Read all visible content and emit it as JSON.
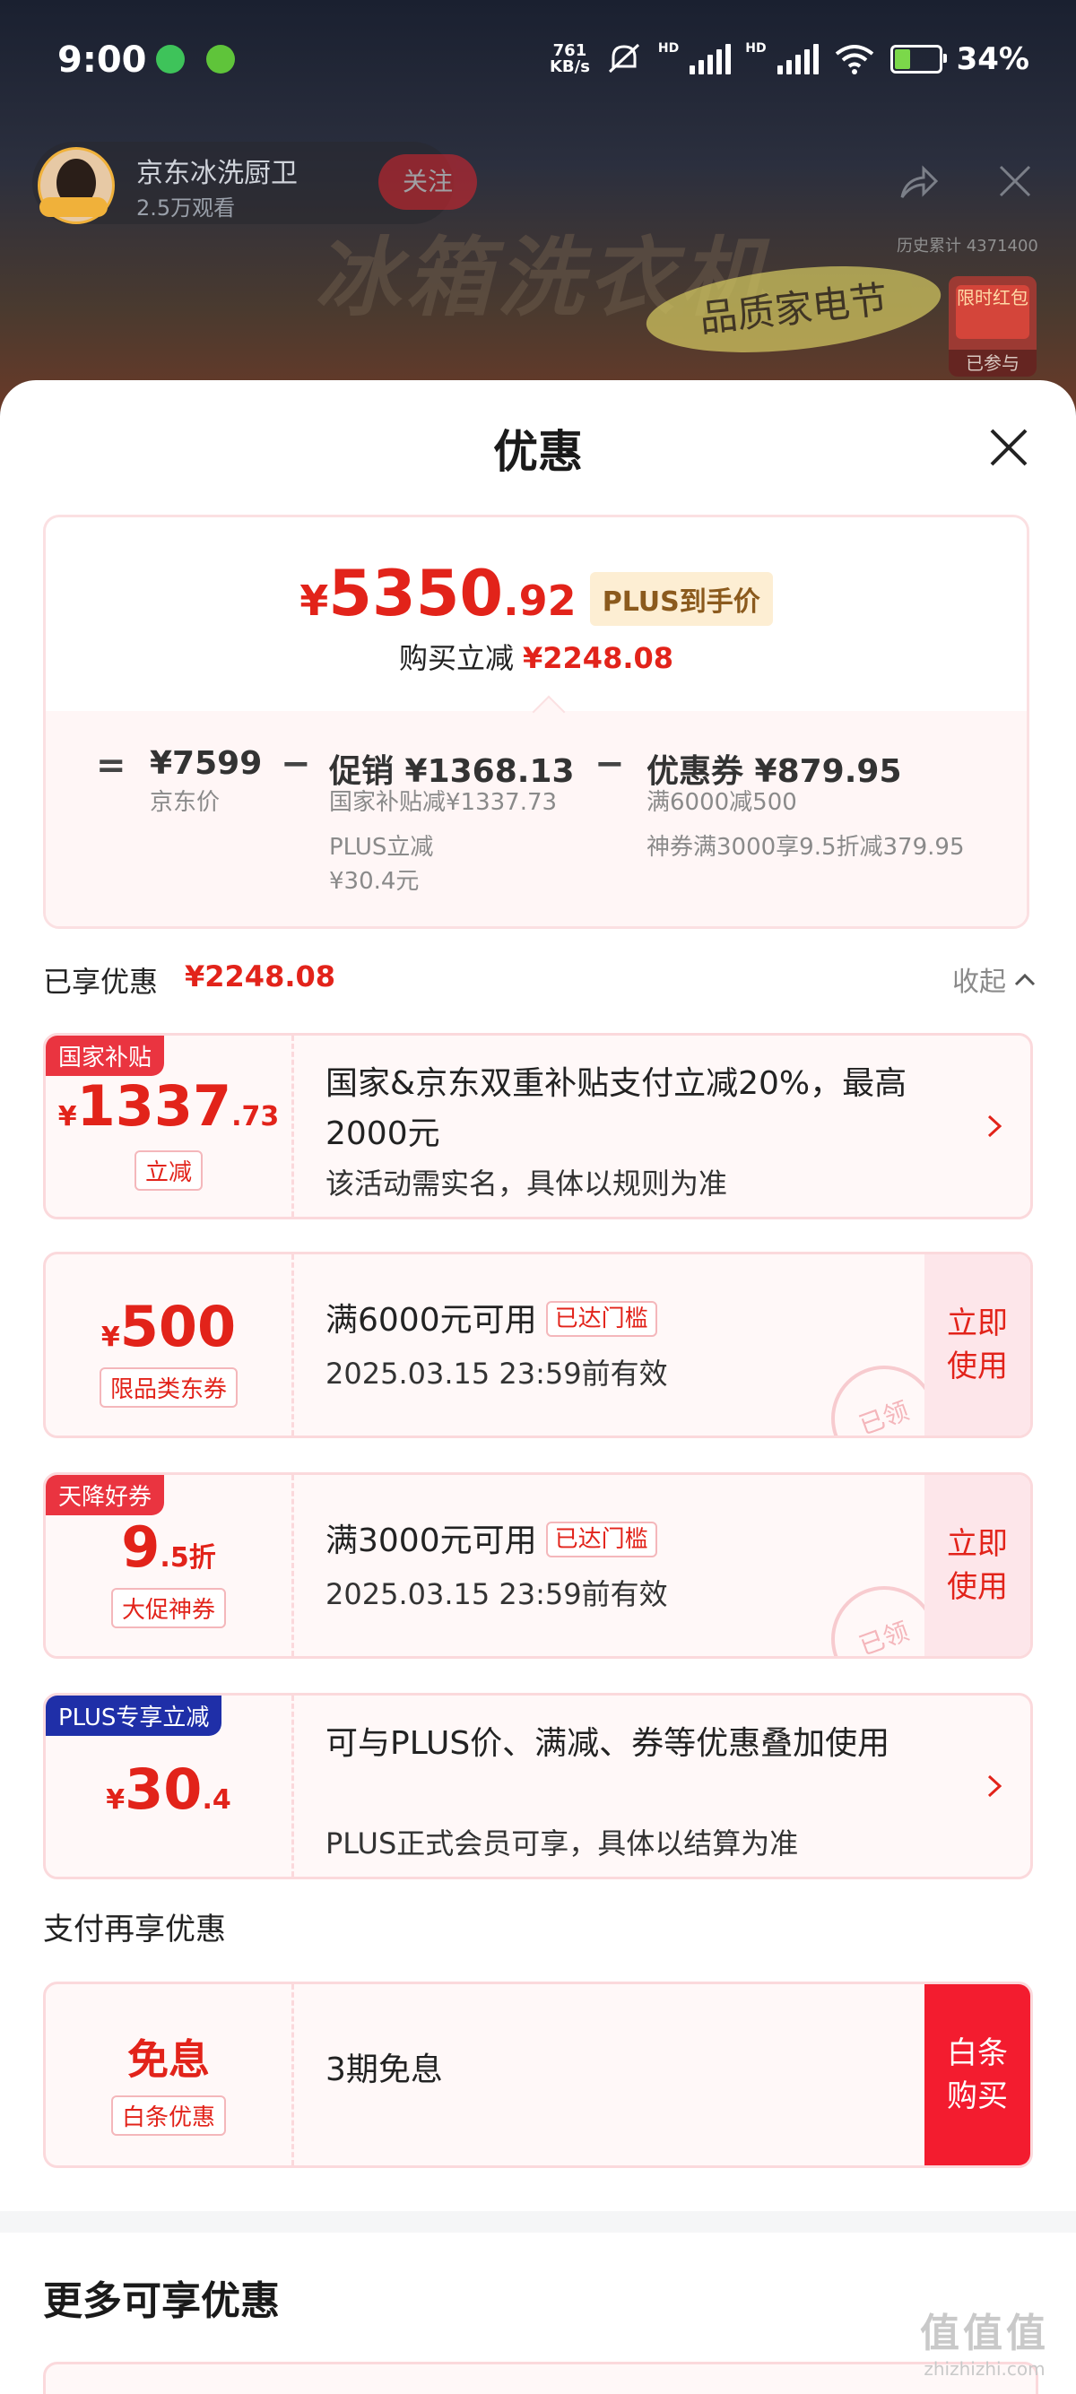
{
  "status": {
    "time": "9:00",
    "speed": "761",
    "speed_unit": "KB/s",
    "hd": "HD",
    "battery": "34%",
    "battery_level": 0.34
  },
  "live": {
    "host_name": "京东冰洗厨卫",
    "views": "2.5万观看",
    "follow": "关注",
    "banner_title": "冰箱洗衣机",
    "banner_sub": "品质家电节",
    "viewer_stat": "历史累计 4371400",
    "red_packet": "限时红包",
    "red_packet_joined": "已参与"
  },
  "sheet": {
    "title": "优惠",
    "summary": {
      "symbol": "¥",
      "price_int": "5350",
      "price_dec": ".92",
      "price_tag": "PLUS到手价",
      "reduce_label": "购买立减",
      "reduce_amount": "¥2248.08",
      "equals": "=",
      "minus": "−",
      "jd_price": "¥7599",
      "jd_price_label": "京东价",
      "promo": "促销 ¥1368.13",
      "promo_detail1": "国家补贴减¥1337.73",
      "promo_detail2": "PLUS立减",
      "promo_detail3": "¥30.4元",
      "coupon": "优惠券 ¥879.95",
      "coupon_detail1": "满6000减500",
      "coupon_detail2": "神券满3000享9.5折减379.95"
    },
    "enjoyed": {
      "label": "已享优惠",
      "amount": "¥2248.08",
      "collapse": "收起"
    },
    "cards": [
      {
        "ribbon": "国家补贴",
        "sym": "¥",
        "big": "1337",
        "dec": ".73",
        "tag": "立减",
        "title": "国家&京东双重补贴支付立减20%，最高2000元",
        "desc": "该活动需实名，具体以规则为准"
      },
      {
        "sym": "¥",
        "big": "500",
        "dec": "",
        "tag": "限品类东券",
        "title": "满6000元可用",
        "badge": "已达门槛",
        "desc": "2025.03.15 23:59前有效",
        "btn": "立即使用",
        "stamp": "已领"
      },
      {
        "ribbon": "天降好券",
        "sym": "",
        "big": "9",
        "dec": ".5折",
        "tag": "大促神券",
        "title": "满3000元可用",
        "badge": "已达门槛",
        "desc": "2025.03.15 23:59前有效",
        "btn": "立即使用",
        "stamp": "已领"
      },
      {
        "ribbon": "PLUS专享立减",
        "sym": "¥",
        "big": "30",
        "dec": ".4",
        "tag": "",
        "title": "可与PLUS价、满减、券等优惠叠加使用",
        "desc": "PLUS正式会员可享，具体以结算为准"
      }
    ],
    "pay_label": "支付再享优惠",
    "pay_card": {
      "big": "免息",
      "tag": "白条优惠",
      "title": "3期免息",
      "btn": "白条购买"
    },
    "more_title": "更多可享优惠"
  },
  "watermark": {
    "line1": "值值值",
    "line2": "zhizhizhi.com"
  },
  "colors": {
    "accent": "#e2231a",
    "buy_button": "#f31c2f",
    "plus_tag_bg": "#fdeed3",
    "plus_ribbon": "#1f2fa8"
  }
}
